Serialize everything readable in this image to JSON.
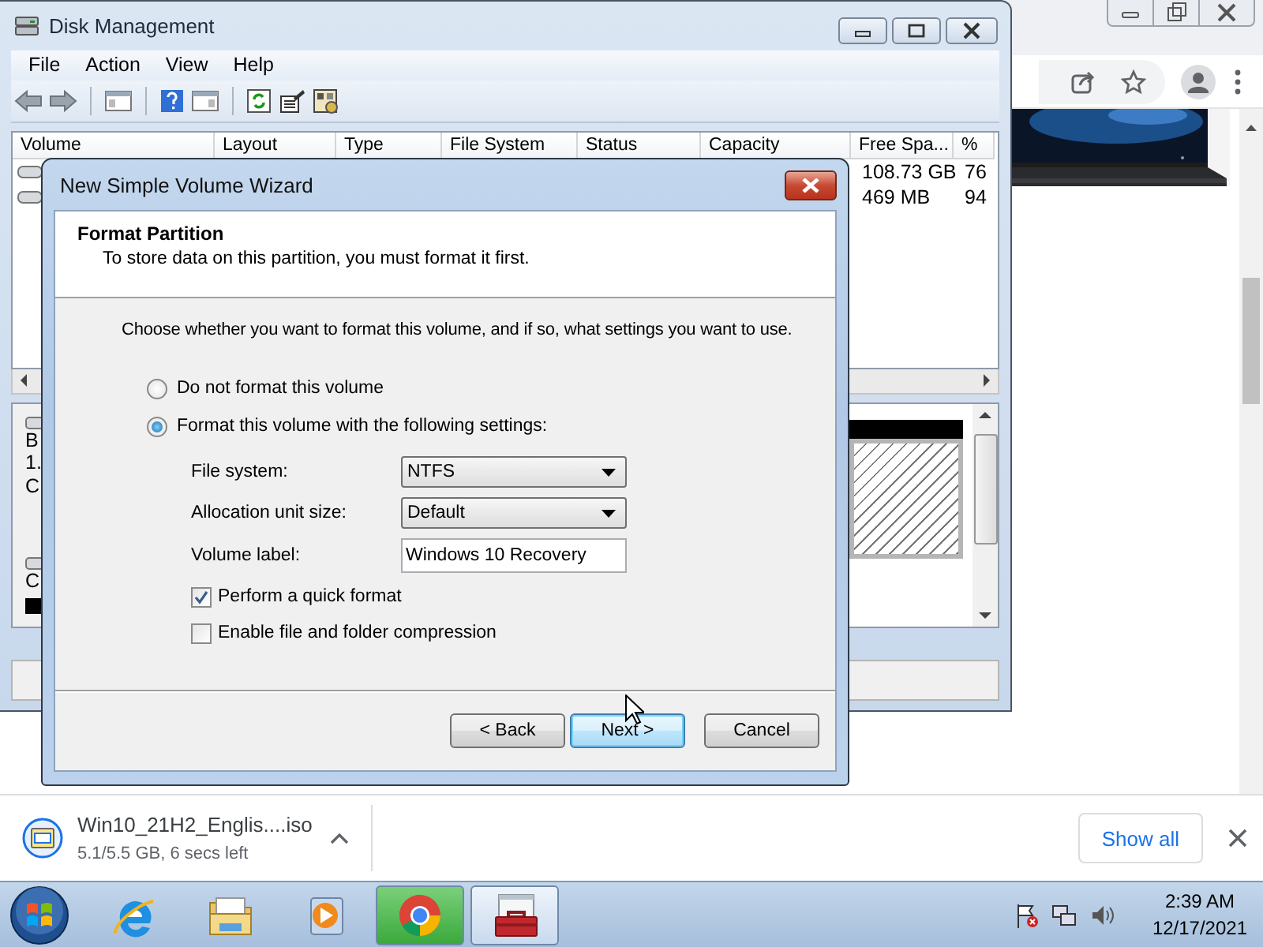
{
  "browser": {
    "download": {
      "file": "Win10_21H2_Englis....iso",
      "status": "5.1/5.5 GB, 6 secs left",
      "show_all": "Show all"
    }
  },
  "disk_management": {
    "title": "Disk Management",
    "menu": [
      "File",
      "Action",
      "View",
      "Help"
    ],
    "columns": [
      "Volume",
      "Layout",
      "Type",
      "File System",
      "Status",
      "Capacity",
      "Free Spa...",
      "%"
    ],
    "rows": [
      {
        "free_space": "108.73 GB",
        "percent": "76"
      },
      {
        "free_space": "469 MB",
        "percent": "94"
      }
    ],
    "disks": [
      {
        "lines": [
          "B",
          "1.",
          "C"
        ]
      },
      {
        "lines": [
          "C"
        ]
      }
    ]
  },
  "wizard": {
    "title": "New Simple Volume Wizard",
    "heading": "Format Partition",
    "subheading": "To store data on this partition, you must format it first.",
    "prompt": "Choose whether you want to format this volume, and if so, what settings you want to use.",
    "options": [
      {
        "label": "Do not format this volume",
        "selected": false
      },
      {
        "label": "Format this volume with the following settings:",
        "selected": true
      }
    ],
    "fields": [
      {
        "kind": "select",
        "label": "File system:",
        "value": "NTFS"
      },
      {
        "kind": "select",
        "label": "Allocation unit size:",
        "value": "Default"
      },
      {
        "kind": "text",
        "label": "Volume label:",
        "value": "Windows 10 Recovery"
      }
    ],
    "checkboxes": [
      {
        "label": "Perform a quick format",
        "checked": true
      },
      {
        "label": "Enable file and folder compression",
        "checked": false
      }
    ],
    "buttons": [
      {
        "label": "< Back",
        "default": false
      },
      {
        "label": "Next >",
        "default": true
      },
      {
        "label": "Cancel",
        "default": false
      }
    ]
  },
  "taskbar": {
    "items": [
      {
        "kind": "browser",
        "active": false
      },
      {
        "kind": "folder",
        "active": false
      },
      {
        "kind": "media",
        "active": false
      },
      {
        "kind": "chrome",
        "active": true
      },
      {
        "kind": "toolbox",
        "active": true
      }
    ],
    "clock": {
      "time": "2:39 AM",
      "date": "12/17/2021"
    }
  }
}
